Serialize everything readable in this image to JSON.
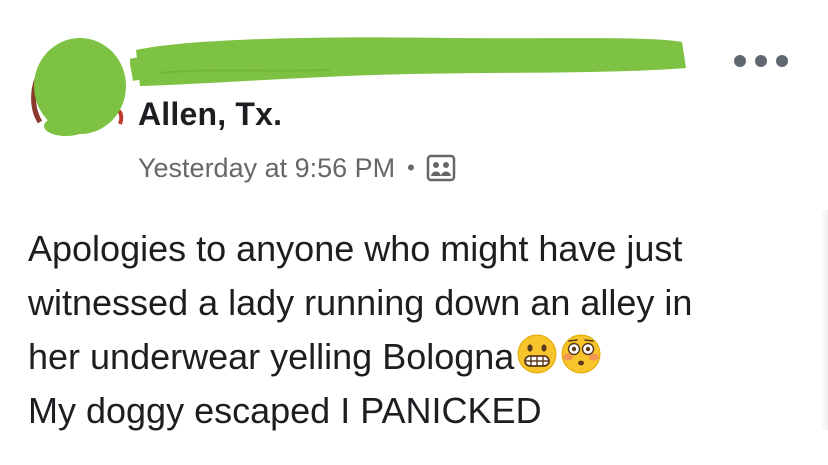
{
  "post": {
    "location": "Allen, Tx.",
    "timestamp": "Yesterday at 9:56 PM",
    "separator": "•",
    "privacy_icon": "public-group-icon",
    "more_icon": "more-options-icon",
    "body_lines": [
      "Apologies to anyone who might have just",
      "witnessed a lady running down an alley in",
      "her underwear yelling Bologna",
      "My doggy escaped I PANICKED"
    ],
    "emojis": [
      "grimacing-face-emoji",
      "flushed-face-emoji"
    ]
  },
  "colors": {
    "redaction_green": "#7dc242",
    "primary_text": "#1c1e21",
    "secondary_text": "#65676b",
    "emoji_yellow": "#f7c52b"
  }
}
